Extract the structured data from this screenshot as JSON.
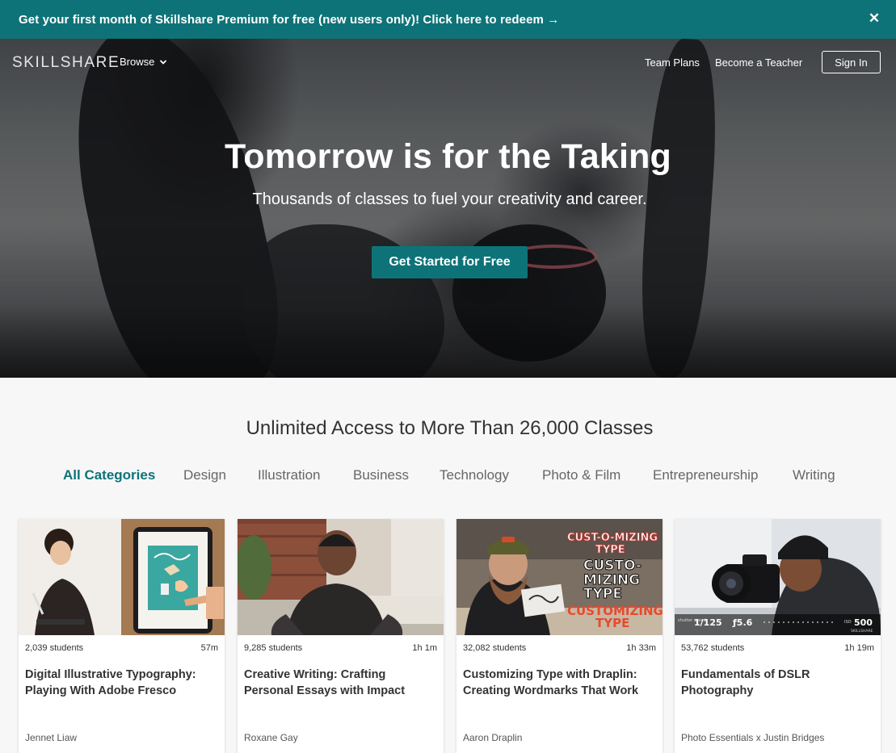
{
  "promo": {
    "text": "Get your first month of Skillshare Premium for free (new users only)! Click here to redeem →",
    "close_glyph": "✕"
  },
  "nav": {
    "logo": "SKILLSHARE",
    "browse": "Browse",
    "team_plans": "Team Plans",
    "become_teacher": "Become a Teacher",
    "sign_in": "Sign In"
  },
  "hero": {
    "title": "Tomorrow is for the Taking",
    "subtitle": "Thousands of classes to fuel your creativity and career.",
    "cta": "Get Started for Free"
  },
  "section": {
    "title": "Unlimited Access to More Than 26,000 Classes"
  },
  "categories": [
    {
      "label": "All Categories",
      "active": true
    },
    {
      "label": "Design",
      "active": false
    },
    {
      "label": "Illustration",
      "active": false
    },
    {
      "label": "Business",
      "active": false
    },
    {
      "label": "Technology",
      "active": false
    },
    {
      "label": "Photo & Film",
      "active": false
    },
    {
      "label": "Entrepreneurship",
      "active": false
    },
    {
      "label": "Writing",
      "active": false
    }
  ],
  "cards": [
    {
      "students": "2,039 students",
      "duration": "57m",
      "title": "Digital Illustrative Typography: Playing With Adobe Fresco",
      "author": "Jennet Liaw"
    },
    {
      "students": "9,285 students",
      "duration": "1h 1m",
      "title": "Creative Writing: Crafting Personal Essays with Impact",
      "author": "Roxane Gay"
    },
    {
      "students": "32,082 students",
      "duration": "1h 33m",
      "title": "Customizing Type with Draplin: Creating Wordmarks That Work",
      "author": "Aaron Draplin"
    },
    {
      "students": "53,762 students",
      "duration": "1h 19m",
      "title": "Fundamentals of DSLR Photography",
      "author": "Photo Essentials x Justin Bridges"
    }
  ],
  "thumb_text": {
    "card3_line1": "CUST-O-MIZING",
    "card3_line2": "TYPE",
    "card3_line3": "CUSTO-",
    "card3_line4": "MIZING",
    "card3_line5": "TYPE",
    "card3_line6": "CUSTOMIZING",
    "card3_line7": "TYPE",
    "card4_shutter_label": "shutter speed",
    "card4_shutter": "1/125",
    "card4_aperture": "ƒ5.6",
    "card4_iso_label": "ISO",
    "card4_iso": "500",
    "card4_brand": "SKILLSHARE"
  },
  "colors": {
    "brand_teal": "#0e7378"
  }
}
